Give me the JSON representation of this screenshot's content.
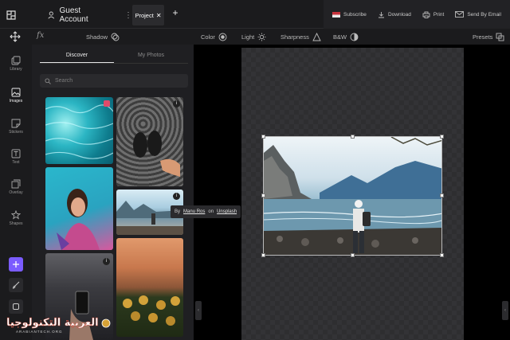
{
  "header": {
    "account_label": "Guest Account",
    "project_tab": "Project",
    "add_tab": "+",
    "right_actions": [
      {
        "label": "Subscribe",
        "icon": "flag-icon"
      },
      {
        "label": "Download",
        "icon": "download-icon"
      },
      {
        "label": "Print",
        "icon": "print-icon"
      },
      {
        "label": "Send By Email",
        "icon": "email-icon"
      }
    ]
  },
  "toolbar": {
    "fx": "fx",
    "shadow": "Shadow",
    "color": "Color",
    "light": "Light",
    "sharpness": "Sharpness",
    "bw": "B&W",
    "presets": "Presets"
  },
  "rail": [
    {
      "label": "Library",
      "icon": "library-icon"
    },
    {
      "label": "Images",
      "icon": "images-icon",
      "active": true
    },
    {
      "label": "Stickers",
      "icon": "stickers-icon"
    },
    {
      "label": "Text",
      "icon": "text-icon"
    },
    {
      "label": "Overlay",
      "icon": "overlay-icon"
    },
    {
      "label": "Shapes",
      "icon": "shapes-icon"
    }
  ],
  "panel": {
    "tabs": [
      "Discover",
      "My Photos"
    ],
    "search_placeholder": "Search"
  },
  "tooltip": {
    "by": "By",
    "author": "Manu Ros",
    "on": "on",
    "source": "Unsplash"
  },
  "watermark": {
    "title": "العربية التكنولوجيا",
    "subtitle": "ARABIANTECH.ORG"
  },
  "colors": {
    "background": "#1b1b1d",
    "panel": "#1f1f22",
    "canvas_bg": "#000000",
    "accent_purple": "#7b5cff"
  }
}
